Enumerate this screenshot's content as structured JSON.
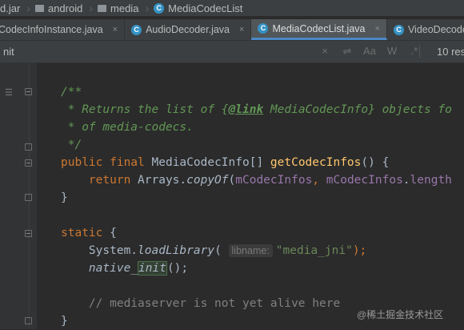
{
  "breadcrumb": {
    "jar": "d.jar",
    "pkg1": "android",
    "pkg2": "media",
    "cls": "MediaCodecList"
  },
  "tabs": [
    {
      "label": "CodecInfoInstance.java",
      "close": "×"
    },
    {
      "label": "AudioDecoder.java",
      "close": "×"
    },
    {
      "label": "MediaCodecList.java",
      "close": "×"
    },
    {
      "label": "VideoDecoder",
      "close": ""
    }
  ],
  "search": {
    "value": "nit",
    "results": "10 res"
  },
  "search_icons": [
    "×",
    "⇌",
    "Aa",
    "W",
    ".*"
  ],
  "code": {
    "l1": "/**",
    "l2a": " * Returns the list of {",
    "l2b": "@link",
    "l2c": " MediaCodecInfo} objects fo",
    "l3": " * of media-codecs.",
    "l4": " */",
    "l5_kw": "public final ",
    "l5_type": "MediaCodecInfo[] ",
    "l5_fn": "getCodecInfos",
    "l5_rest": "() {",
    "l6_kw": "    return ",
    "l6_a": "Arrays.",
    "l6_m": "copyOf",
    "l6_b": "(",
    "l6_f1": "mCodecInfos",
    "l6_c": ", ",
    "l6_f2": "mCodecInfos",
    "l6_d": ".",
    "l6_f3": "length",
    "l7": "}",
    "l9_kw": "static",
    "l9_rest": " {",
    "l10_a": "    System.",
    "l10_m": "loadLibrary",
    "l10_b": "( ",
    "l10_hint": "libname:",
    "l10_str": "\"media_jni\"",
    "l10_c": ");",
    "l11_a": "    ",
    "l11_m1": "native_",
    "l11_m2": "init",
    "l11_b": "();",
    "l13": "    // mediaserver is not yet alive here",
    "l14": "}"
  },
  "watermark": "@稀土掘金技术社区"
}
